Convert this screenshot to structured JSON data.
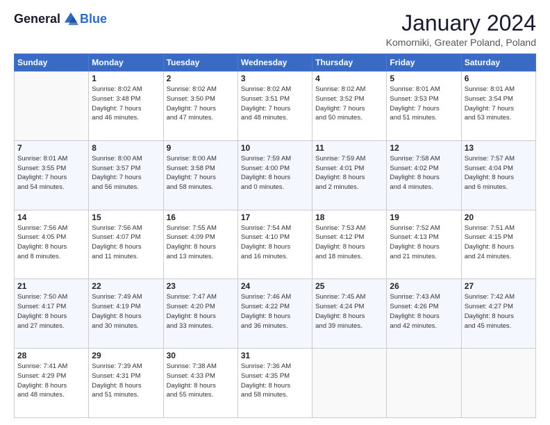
{
  "header": {
    "logo": {
      "general": "General",
      "blue": "Blue"
    },
    "title": "January 2024",
    "location": "Komorniki, Greater Poland, Poland"
  },
  "days_of_week": [
    "Sunday",
    "Monday",
    "Tuesday",
    "Wednesday",
    "Thursday",
    "Friday",
    "Saturday"
  ],
  "weeks": [
    [
      {
        "day": "",
        "info": ""
      },
      {
        "day": "1",
        "info": "Sunrise: 8:02 AM\nSunset: 3:48 PM\nDaylight: 7 hours\nand 46 minutes."
      },
      {
        "day": "2",
        "info": "Sunrise: 8:02 AM\nSunset: 3:50 PM\nDaylight: 7 hours\nand 47 minutes."
      },
      {
        "day": "3",
        "info": "Sunrise: 8:02 AM\nSunset: 3:51 PM\nDaylight: 7 hours\nand 48 minutes."
      },
      {
        "day": "4",
        "info": "Sunrise: 8:02 AM\nSunset: 3:52 PM\nDaylight: 7 hours\nand 50 minutes."
      },
      {
        "day": "5",
        "info": "Sunrise: 8:01 AM\nSunset: 3:53 PM\nDaylight: 7 hours\nand 51 minutes."
      },
      {
        "day": "6",
        "info": "Sunrise: 8:01 AM\nSunset: 3:54 PM\nDaylight: 7 hours\nand 53 minutes."
      }
    ],
    [
      {
        "day": "7",
        "info": "Sunrise: 8:01 AM\nSunset: 3:55 PM\nDaylight: 7 hours\nand 54 minutes."
      },
      {
        "day": "8",
        "info": "Sunrise: 8:00 AM\nSunset: 3:57 PM\nDaylight: 7 hours\nand 56 minutes."
      },
      {
        "day": "9",
        "info": "Sunrise: 8:00 AM\nSunset: 3:58 PM\nDaylight: 7 hours\nand 58 minutes."
      },
      {
        "day": "10",
        "info": "Sunrise: 7:59 AM\nSunset: 4:00 PM\nDaylight: 8 hours\nand 0 minutes."
      },
      {
        "day": "11",
        "info": "Sunrise: 7:59 AM\nSunset: 4:01 PM\nDaylight: 8 hours\nand 2 minutes."
      },
      {
        "day": "12",
        "info": "Sunrise: 7:58 AM\nSunset: 4:02 PM\nDaylight: 8 hours\nand 4 minutes."
      },
      {
        "day": "13",
        "info": "Sunrise: 7:57 AM\nSunset: 4:04 PM\nDaylight: 8 hours\nand 6 minutes."
      }
    ],
    [
      {
        "day": "14",
        "info": "Sunrise: 7:56 AM\nSunset: 4:05 PM\nDaylight: 8 hours\nand 8 minutes."
      },
      {
        "day": "15",
        "info": "Sunrise: 7:56 AM\nSunset: 4:07 PM\nDaylight: 8 hours\nand 11 minutes."
      },
      {
        "day": "16",
        "info": "Sunrise: 7:55 AM\nSunset: 4:09 PM\nDaylight: 8 hours\nand 13 minutes."
      },
      {
        "day": "17",
        "info": "Sunrise: 7:54 AM\nSunset: 4:10 PM\nDaylight: 8 hours\nand 16 minutes."
      },
      {
        "day": "18",
        "info": "Sunrise: 7:53 AM\nSunset: 4:12 PM\nDaylight: 8 hours\nand 18 minutes."
      },
      {
        "day": "19",
        "info": "Sunrise: 7:52 AM\nSunset: 4:13 PM\nDaylight: 8 hours\nand 21 minutes."
      },
      {
        "day": "20",
        "info": "Sunrise: 7:51 AM\nSunset: 4:15 PM\nDaylight: 8 hours\nand 24 minutes."
      }
    ],
    [
      {
        "day": "21",
        "info": "Sunrise: 7:50 AM\nSunset: 4:17 PM\nDaylight: 8 hours\nand 27 minutes."
      },
      {
        "day": "22",
        "info": "Sunrise: 7:49 AM\nSunset: 4:19 PM\nDaylight: 8 hours\nand 30 minutes."
      },
      {
        "day": "23",
        "info": "Sunrise: 7:47 AM\nSunset: 4:20 PM\nDaylight: 8 hours\nand 33 minutes."
      },
      {
        "day": "24",
        "info": "Sunrise: 7:46 AM\nSunset: 4:22 PM\nDaylight: 8 hours\nand 36 minutes."
      },
      {
        "day": "25",
        "info": "Sunrise: 7:45 AM\nSunset: 4:24 PM\nDaylight: 8 hours\nand 39 minutes."
      },
      {
        "day": "26",
        "info": "Sunrise: 7:43 AM\nSunset: 4:26 PM\nDaylight: 8 hours\nand 42 minutes."
      },
      {
        "day": "27",
        "info": "Sunrise: 7:42 AM\nSunset: 4:27 PM\nDaylight: 8 hours\nand 45 minutes."
      }
    ],
    [
      {
        "day": "28",
        "info": "Sunrise: 7:41 AM\nSunset: 4:29 PM\nDaylight: 8 hours\nand 48 minutes."
      },
      {
        "day": "29",
        "info": "Sunrise: 7:39 AM\nSunset: 4:31 PM\nDaylight: 8 hours\nand 51 minutes."
      },
      {
        "day": "30",
        "info": "Sunrise: 7:38 AM\nSunset: 4:33 PM\nDaylight: 8 hours\nand 55 minutes."
      },
      {
        "day": "31",
        "info": "Sunrise: 7:36 AM\nSunset: 4:35 PM\nDaylight: 8 hours\nand 58 minutes."
      },
      {
        "day": "",
        "info": ""
      },
      {
        "day": "",
        "info": ""
      },
      {
        "day": "",
        "info": ""
      }
    ]
  ]
}
